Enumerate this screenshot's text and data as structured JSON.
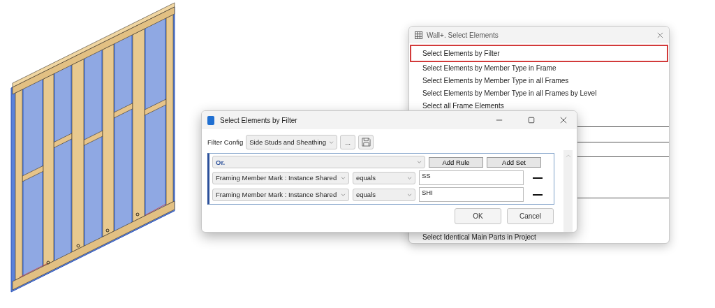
{
  "back_window": {
    "title": "Wall+. Select Elements",
    "items": [
      {
        "label": "Select Elements by Filter",
        "selected": true
      },
      {
        "label": "Select Elements by Member Type in Frame",
        "selected": false
      },
      {
        "label": "Select Elements by Member Type in all Frames",
        "selected": false
      },
      {
        "label": "Select Elements by Member Type in all Frames by Level",
        "selected": false
      },
      {
        "label": "Select all Frame Elements",
        "selected": false
      },
      {
        "label": "Select Identical Main Parts in Project",
        "selected": false
      }
    ]
  },
  "front_window": {
    "title": "Select Elements by Filter",
    "filter_config": {
      "label": "Filter Config",
      "value": "Side Studs and Sheathing"
    },
    "more_button": "...",
    "rule_set": {
      "operator": "Or.",
      "add_rule": "Add Rule",
      "add_set": "Add Set",
      "rules": [
        {
          "parameter": "Framing Member Mark : Instance Shared",
          "condition": "equals",
          "value": "SS"
        },
        {
          "parameter": "Framing Member Mark : Instance Shared",
          "condition": "equals",
          "value": "SHI"
        }
      ]
    },
    "buttons": [
      "OK",
      "Cancel"
    ]
  }
}
